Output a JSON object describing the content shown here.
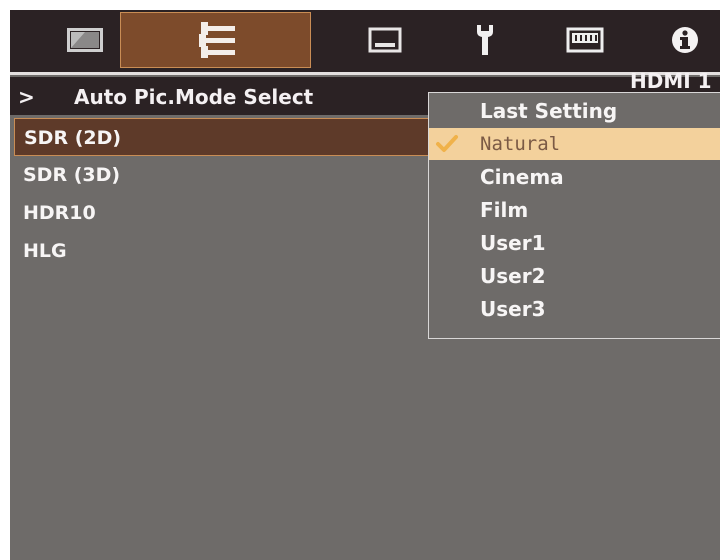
{
  "tabs": [
    {
      "name": "picture-tab",
      "icon": "picture-icon",
      "active": false
    },
    {
      "name": "adjust-tab",
      "icon": "sliders-icon",
      "active": true
    },
    {
      "name": "display-tab",
      "icon": "display-icon",
      "active": false
    },
    {
      "name": "setup-tab",
      "icon": "wrench-icon",
      "active": false
    },
    {
      "name": "install-tab",
      "icon": "memory-icon",
      "active": false
    },
    {
      "name": "info-tab",
      "icon": "info-icon",
      "active": false
    }
  ],
  "header": {
    "arrow": ">",
    "title": "Auto Pic.Mode Select",
    "source": "HDMI 1"
  },
  "left_list": {
    "items": [
      "SDR (2D)",
      "SDR (3D)",
      "HDR10",
      "HLG"
    ],
    "selected_index": 0
  },
  "dropdown": {
    "items": [
      "Last Setting",
      "Natural",
      "Cinema",
      "Film",
      "User1",
      "User2",
      "User3"
    ],
    "selected_index": 1,
    "check_icon": "check-icon"
  },
  "colors": {
    "background": "#6e6b69",
    "tabbar": "#2b2224",
    "accent": "#c98d55",
    "highlight": "#f3d19c",
    "check": "#f0b24a"
  }
}
